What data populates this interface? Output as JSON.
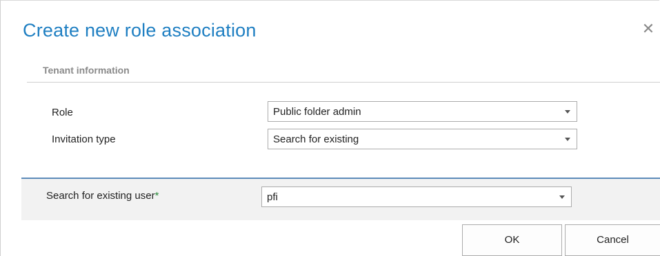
{
  "dialog": {
    "title": "Create new role association",
    "close_icon": "close-icon"
  },
  "section": {
    "title": "Tenant information"
  },
  "form": {
    "role": {
      "label": "Role",
      "value": "Public folder admin"
    },
    "invitation_type": {
      "label": "Invitation type",
      "value": "Search for existing"
    }
  },
  "search": {
    "label": "Search for existing user",
    "required_mark": "*",
    "value": "pfi"
  },
  "buttons": {
    "ok": "OK",
    "cancel": "Cancel"
  },
  "colors": {
    "title": "#1f7fc2",
    "panel_border": "#5b8ab8",
    "panel_bg": "#f2f2f2",
    "required": "#2a8a3a"
  }
}
